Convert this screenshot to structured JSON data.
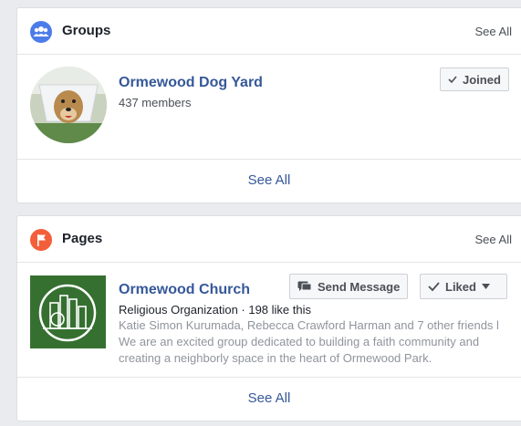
{
  "colors": {
    "groups_icon": "#4c7ce8",
    "pages_icon": "#f25f3a",
    "link": "#365899"
  },
  "groups": {
    "title": "Groups",
    "header_see_all": "See All",
    "item": {
      "name": "Ormewood Dog Yard",
      "members": "437 members",
      "joined_label": "Joined"
    },
    "footer_see_all": "See All"
  },
  "pages": {
    "title": "Pages",
    "header_see_all": "See All",
    "item": {
      "name": "Ormewood Church",
      "category_line": "Religious Organization · 198 like this",
      "friends_line": "Katie Simon Kurumada, Rebecca Crawford Harman and 7 other friends l",
      "description_line1": "We are an excited group dedicated to building a faith community and",
      "description_line2": "creating a neighborly space in the heart of Ormewood Park.",
      "send_message_label": "Send Message",
      "liked_label": "Liked"
    },
    "footer_see_all": "See All"
  }
}
